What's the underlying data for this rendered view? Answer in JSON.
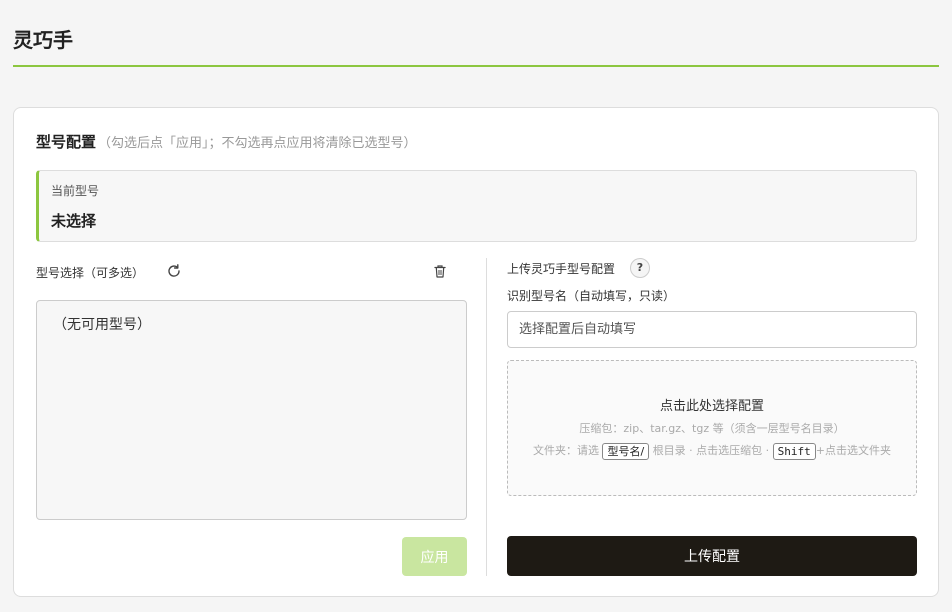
{
  "app": {
    "title": "灵巧手"
  },
  "section": {
    "title": "型号配置",
    "hint": "（勾选后点「应用」；不勾选再点应用将清除已选型号）"
  },
  "current": {
    "label": "当前型号",
    "value": "未选择"
  },
  "model_select": {
    "label": "型号选择（可多选）",
    "empty_text": "（无可用型号）",
    "apply_label": "应用",
    "refresh_icon": "refresh-icon",
    "trash_icon": "trash-icon"
  },
  "upload": {
    "title": "上传灵巧手型号配置",
    "help": "?",
    "name_label": "识别型号名（自动填写，只读）",
    "name_placeholder": "选择配置后自动填写",
    "dropzone": {
      "title": "点击此处选择配置",
      "formats": "压缩包：zip、tar.gz、tgz 等（须含一层型号名目录）",
      "folder_prefix": "文件夹：请选",
      "folder_kbd": "型号名/",
      "folder_middle": "根目录 · 点击选压缩包 ·",
      "shift_kbd": "Shift",
      "folder_suffix": "+点击选文件夹"
    },
    "button_label": "上传配置"
  },
  "colors": {
    "accent": "#8cc63f",
    "apply_disabled_bg": "#c9e6a0",
    "upload_button_bg": "#1e1a14"
  }
}
